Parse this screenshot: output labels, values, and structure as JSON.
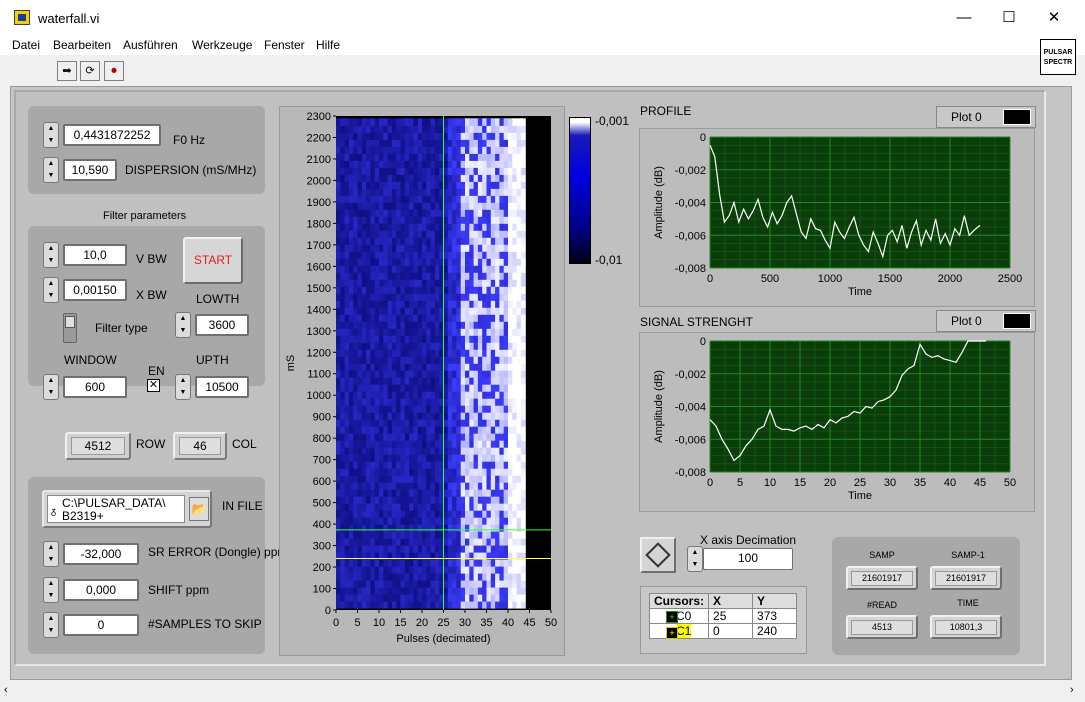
{
  "window": {
    "title": "waterfall.vi",
    "min": "—",
    "max": "☐",
    "close": "✕"
  },
  "menu": [
    "Datei",
    "Bearbeiten",
    "Ausführen",
    "Werkzeuge",
    "Fenster",
    "Hilfe"
  ],
  "toolbar": {
    "run": "➡",
    "run_cont": "⟳",
    "abort": "⏺"
  },
  "vi_logo": "PULSAR SPECTR",
  "controls": {
    "f0": {
      "value": "0,4431872252",
      "label": "F0 Hz"
    },
    "dispersion": {
      "value": "10,590",
      "label": "DISPERSION (mS/MHz)"
    },
    "filter_title": "Filter parameters",
    "vbw": {
      "value": "10,0",
      "label": "V BW"
    },
    "xbw": {
      "value": "0,00150",
      "label": "X BW"
    },
    "start": "START",
    "lowth": {
      "value": "3600",
      "label": "LOWTH"
    },
    "filter_type": "Filter type",
    "window": {
      "value": "600",
      "label": "WINDOW"
    },
    "en": "EN",
    "upth": {
      "value": "10500",
      "label": "UPTH"
    },
    "row": {
      "value": "4512",
      "label": "ROW"
    },
    "col": {
      "value": "46",
      "label": "COL"
    },
    "infile": {
      "value": "C:\\PULSAR_DATA\\ B2319+",
      "line1": "C:\\PULSAR_DATA\\",
      "line2": "B2319+",
      "label": "IN FILE"
    },
    "sr_error": {
      "value": "-32,000",
      "label": "SR ERROR (Dongle) ppm"
    },
    "shift": {
      "value": "0,000",
      "label": "SHIFT ppm"
    },
    "skip": {
      "value": "0",
      "label": "#SAMPLES TO SKIP"
    }
  },
  "waterfall": {
    "ylabel": "mS",
    "xlabel": "Pulses (decimated)",
    "yticks": [
      "2300",
      "2200",
      "2100",
      "2000",
      "1900",
      "1800",
      "1700",
      "1600",
      "1500",
      "1400",
      "1300",
      "1200",
      "1100",
      "1000",
      "900",
      "800",
      "700",
      "600",
      "500",
      "400",
      "300",
      "200",
      "100",
      "0"
    ],
    "xticks": [
      "0",
      "5",
      "10",
      "15",
      "20",
      "25",
      "30",
      "35",
      "40",
      "45",
      "50"
    ],
    "scale_top": "-0,001",
    "scale_bottom": "-0,01"
  },
  "profile": {
    "title": "PROFILE",
    "legend": "Plot 0",
    "ylabel": "Amplitude (dB)",
    "xlabel": "Time",
    "yticks": [
      "0",
      "-0,002",
      "-0,004",
      "-0,006",
      "-0,008"
    ],
    "xticks": [
      "0",
      "500",
      "1000",
      "1500",
      "2000",
      "2500"
    ]
  },
  "signal": {
    "title": "SIGNAL STRENGHT",
    "legend": "Plot 0",
    "ylabel": "Amplitude (dB)",
    "xlabel": "Time",
    "yticks": [
      "0",
      "-0,002",
      "-0,004",
      "-0,006",
      "-0,008"
    ],
    "xticks": [
      "0",
      "5",
      "10",
      "15",
      "20",
      "25",
      "30",
      "35",
      "40",
      "45",
      "50"
    ]
  },
  "decimation": {
    "label": "X axis Decimation",
    "value": "100"
  },
  "cursors": {
    "header": [
      "Cursors:",
      "X",
      "Y"
    ],
    "rows": [
      {
        "name": "C0",
        "x": "25",
        "y": "373"
      },
      {
        "name": "C1",
        "x": "0",
        "y": "240"
      }
    ]
  },
  "samp": {
    "samp_label": "SAMP",
    "samp": "21601917",
    "samp1_label": "SAMP-1",
    "samp1": "21601917",
    "read_label": "#READ",
    "read": "4513",
    "time_label": "TIME",
    "time": "10801,3"
  },
  "colors": {
    "plot_bg": "#0b3d0b",
    "grid": "#1f8a1f",
    "trace": "#ffffff",
    "accent": "#e02020"
  },
  "chart_data": [
    {
      "type": "line",
      "title": "PROFILE",
      "xlabel": "Time",
      "ylabel": "Amplitude (dB)",
      "xlim": [
        0,
        2500
      ],
      "ylim": [
        -0.008,
        0
      ],
      "series": [
        {
          "x": [
            0,
            40,
            80,
            120,
            160,
            200,
            240,
            280,
            320,
            360,
            400,
            440,
            480,
            520,
            560,
            600,
            640,
            680,
            720,
            760,
            800,
            840,
            880,
            920,
            960,
            1000,
            1040,
            1080,
            1120,
            1160,
            1200,
            1240,
            1280,
            1320,
            1360,
            1400,
            1440,
            1480,
            1520,
            1560,
            1600,
            1640,
            1680,
            1720,
            1760,
            1800,
            1840,
            1880,
            1920,
            1960,
            2000,
            2040,
            2080,
            2120,
            2160,
            2200,
            2250
          ],
          "y": [
            -0.0005,
            -0.0012,
            -0.0035,
            -0.0052,
            -0.0048,
            -0.004,
            -0.0052,
            -0.0044,
            -0.005,
            -0.0045,
            -0.0038,
            -0.0049,
            -0.0055,
            -0.0046,
            -0.0053,
            -0.0048,
            -0.004,
            -0.0036,
            -0.0047,
            -0.0058,
            -0.0062,
            -0.005,
            -0.0056,
            -0.0057,
            -0.0063,
            -0.0068,
            -0.0052,
            -0.0058,
            -0.0062,
            -0.0055,
            -0.0049,
            -0.006,
            -0.0066,
            -0.007,
            -0.0058,
            -0.0065,
            -0.0073,
            -0.006,
            -0.0057,
            -0.0064,
            -0.0054,
            -0.0068,
            -0.0058,
            -0.0051,
            -0.0066,
            -0.0057,
            -0.0063,
            -0.005,
            -0.0065,
            -0.0059,
            -0.0066,
            -0.0056,
            -0.006,
            -0.0048,
            -0.006,
            -0.0057,
            -0.0054
          ]
        }
      ]
    },
    {
      "type": "line",
      "title": "SIGNAL STRENGHT",
      "xlabel": "Time",
      "ylabel": "Amplitude (dB)",
      "xlim": [
        0,
        50
      ],
      "ylim": [
        -0.008,
        0
      ],
      "series": [
        {
          "x": [
            0,
            1,
            2,
            3,
            4,
            5,
            6,
            7,
            8,
            9,
            10,
            11,
            12,
            13,
            14,
            15,
            16,
            17,
            18,
            19,
            20,
            21,
            22,
            23,
            24,
            25,
            26,
            27,
            28,
            29,
            30,
            31,
            32,
            33,
            34,
            35,
            36,
            37,
            38,
            39,
            40,
            41,
            42,
            43,
            44,
            45,
            46
          ],
          "y": [
            -0.0048,
            -0.0052,
            -0.006,
            -0.0066,
            -0.0073,
            -0.007,
            -0.0064,
            -0.006,
            -0.0054,
            -0.0052,
            -0.0042,
            -0.0052,
            -0.0054,
            -0.0054,
            -0.0055,
            -0.0053,
            -0.0052,
            -0.0054,
            -0.0051,
            -0.0053,
            -0.0048,
            -0.005,
            -0.0047,
            -0.0046,
            -0.0043,
            -0.0044,
            -0.004,
            -0.0041,
            -0.0037,
            -0.0036,
            -0.0034,
            -0.003,
            -0.0021,
            -0.0017,
            -0.0015,
            -0.0002,
            -0.0008,
            -0.001,
            -0.0009,
            -0.0011,
            -0.0012,
            -0.0013,
            -0.0007,
            0.0,
            0.0,
            0.0,
            0.0
          ]
        }
      ]
    }
  ]
}
